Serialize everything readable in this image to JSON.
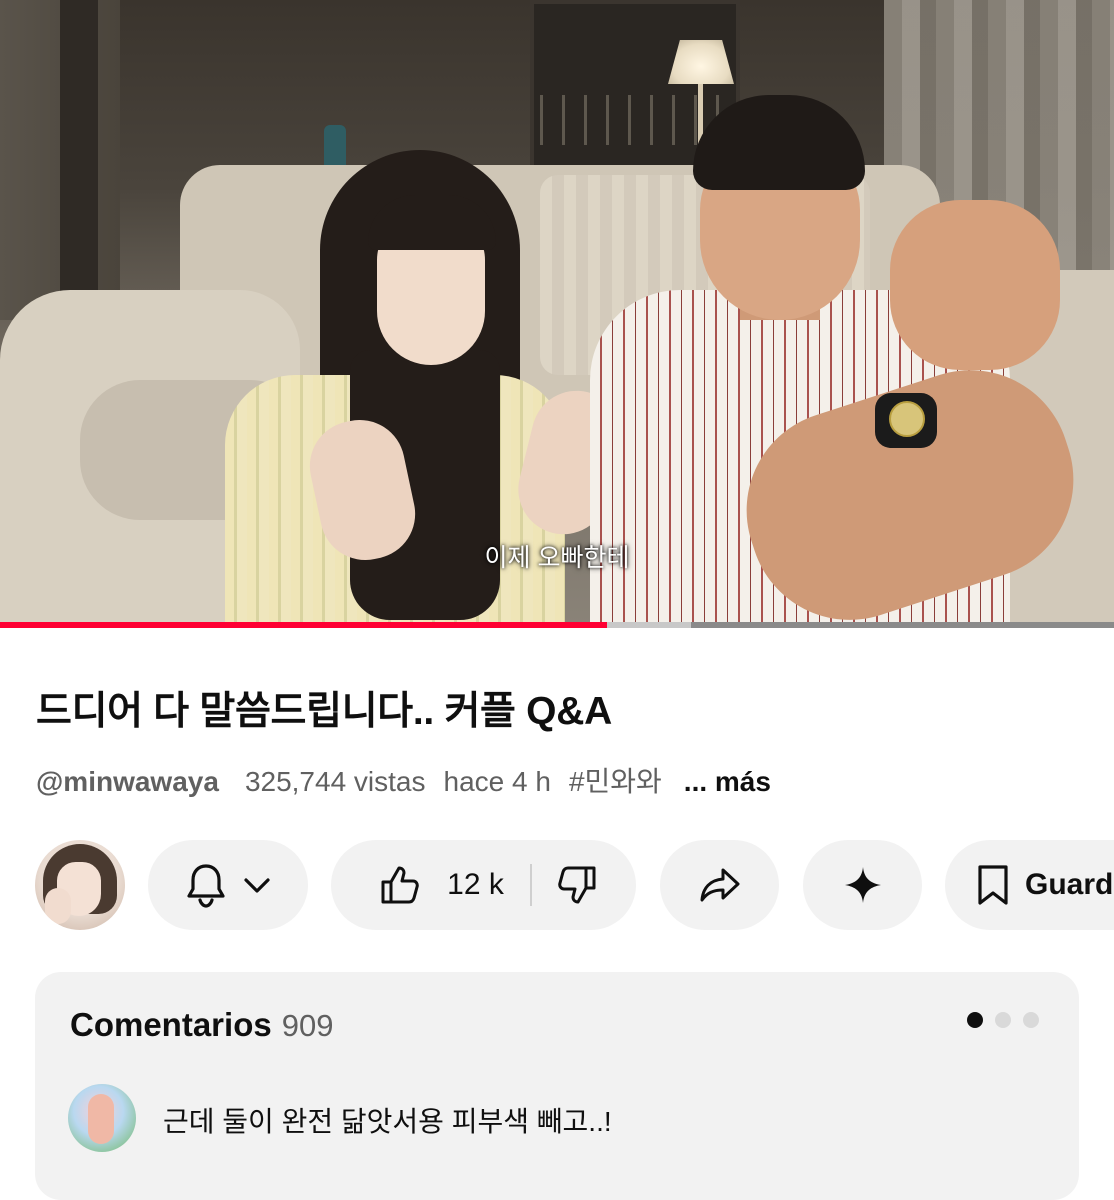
{
  "video": {
    "subtitle": "이제 오빠한테",
    "progress_fraction": 0.545,
    "buffered_fraction": 0.62,
    "progress_color": "#ff0033"
  },
  "title": "드디어 다 말씀드립니다.. 커플 Q&A",
  "meta": {
    "channel": "@minwawaya",
    "views": "325,744 vistas",
    "age": "hace 4 h",
    "hashtag": "#민와와",
    "more": "... más"
  },
  "actions": {
    "subscribe_icon": "bell-icon",
    "dropdown_icon": "chevron-down-icon",
    "likes": "12 k",
    "like_icon": "thumbs-up-icon",
    "dislike_icon": "thumbs-down-icon",
    "share_icon": "share-arrow-icon",
    "remix_icon": "sparkle-icon",
    "save_icon": "bookmark-icon",
    "save_label": "Guard"
  },
  "comments": {
    "title": "Comentarios",
    "count": "909",
    "pager_dots": 3,
    "active_dot": 0,
    "top_comment": "근데 둘이 완전 닮앗서용 피부색 빼고..!"
  }
}
